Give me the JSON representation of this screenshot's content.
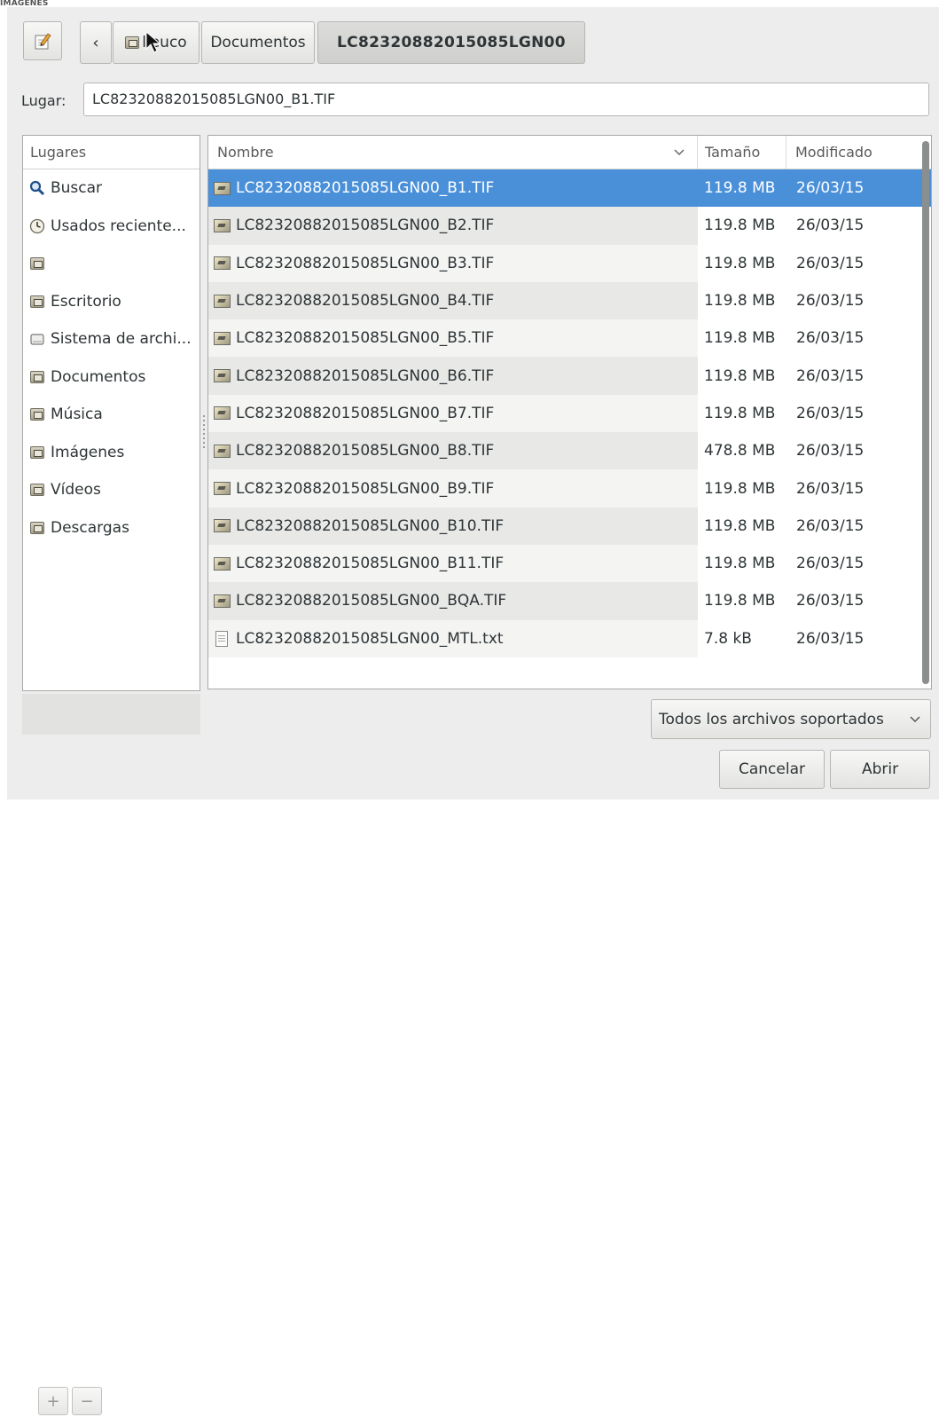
{
  "window_caption": "IMÁGENES",
  "path_bar": {
    "back_icon": "‹",
    "crumbs": [
      "lleuco",
      "Documentos",
      "LC82320882015085LGN00"
    ]
  },
  "location": {
    "label": "Lugar:",
    "value": "LC82320882015085LGN00_B1.TIF"
  },
  "places": {
    "header": "Lugares",
    "items": [
      {
        "label": "Buscar",
        "icon": "search-icon"
      },
      {
        "label": "Usados reciente...",
        "icon": "recent-icon"
      },
      {
        "label": "",
        "icon": "home-folder-icon"
      },
      {
        "label": "Escritorio",
        "icon": "desktop-folder-icon"
      },
      {
        "label": "Sistema de archi...",
        "icon": "filesystem-icon"
      },
      {
        "label": "Documentos",
        "icon": "documents-folder-icon"
      },
      {
        "label": "Música",
        "icon": "music-folder-icon"
      },
      {
        "label": "Imágenes",
        "icon": "pictures-folder-icon"
      },
      {
        "label": "Vídeos",
        "icon": "videos-folder-icon"
      },
      {
        "label": "Descargas",
        "icon": "downloads-folder-icon"
      }
    ],
    "add_label": "+",
    "remove_label": "−"
  },
  "files": {
    "columns": {
      "name": "Nombre",
      "size": "Tamaño",
      "modified": "Modificado"
    },
    "rows": [
      {
        "name": "LC82320882015085LGN00_B1.TIF",
        "size": "119.8 MB",
        "modified": "26/03/15",
        "selected": true,
        "kind": "image"
      },
      {
        "name": "LC82320882015085LGN00_B2.TIF",
        "size": "119.8 MB",
        "modified": "26/03/15",
        "kind": "image"
      },
      {
        "name": "LC82320882015085LGN00_B3.TIF",
        "size": "119.8 MB",
        "modified": "26/03/15",
        "kind": "image"
      },
      {
        "name": "LC82320882015085LGN00_B4.TIF",
        "size": "119.8 MB",
        "modified": "26/03/15",
        "kind": "image"
      },
      {
        "name": "LC82320882015085LGN00_B5.TIF",
        "size": "119.8 MB",
        "modified": "26/03/15",
        "kind": "image"
      },
      {
        "name": "LC82320882015085LGN00_B6.TIF",
        "size": "119.8 MB",
        "modified": "26/03/15",
        "kind": "image"
      },
      {
        "name": "LC82320882015085LGN00_B7.TIF",
        "size": "119.8 MB",
        "modified": "26/03/15",
        "kind": "image"
      },
      {
        "name": "LC82320882015085LGN00_B8.TIF",
        "size": "478.8 MB",
        "modified": "26/03/15",
        "kind": "image"
      },
      {
        "name": "LC82320882015085LGN00_B9.TIF",
        "size": "119.8 MB",
        "modified": "26/03/15",
        "kind": "image"
      },
      {
        "name": "LC82320882015085LGN00_B10.TIF",
        "size": "119.8 MB",
        "modified": "26/03/15",
        "kind": "image"
      },
      {
        "name": "LC82320882015085LGN00_B11.TIF",
        "size": "119.8 MB",
        "modified": "26/03/15",
        "kind": "image"
      },
      {
        "name": "LC82320882015085LGN00_BQA.TIF",
        "size": "119.8 MB",
        "modified": "26/03/15",
        "kind": "image"
      },
      {
        "name": "LC82320882015085LGN00_MTL.txt",
        "size": "7.8 kB",
        "modified": "26/03/15",
        "kind": "text"
      }
    ]
  },
  "filter": {
    "label": "Todos los archivos soportados",
    "icon": "chevron-down-icon"
  },
  "buttons": {
    "cancel": "Cancelar",
    "open": "Abrir"
  },
  "colors": {
    "selection": "#4a90d9",
    "window_bg": "#ededed"
  }
}
